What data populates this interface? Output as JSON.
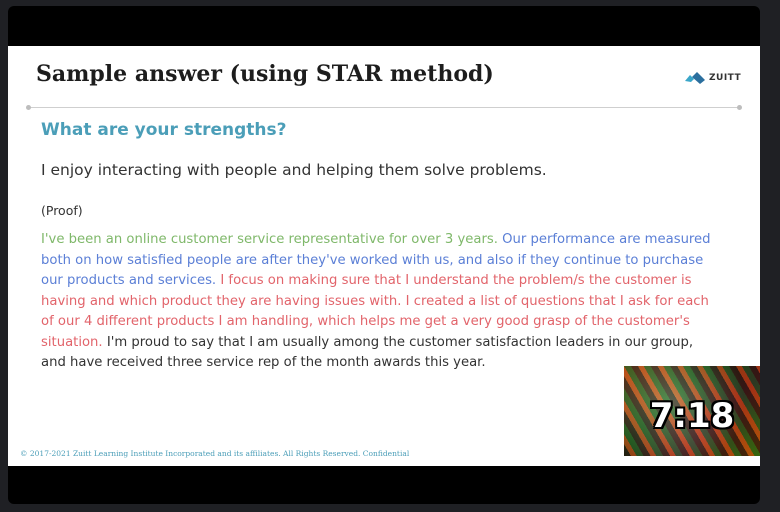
{
  "slide": {
    "title": "Sample answer (using STAR method)",
    "logo_text": "ZUITT",
    "question": "What are your strengths?",
    "statement": "I enjoy interacting with people and helping them solve problems.",
    "proof_label": "(Proof)",
    "answer": {
      "situation": "I've been an online customer service representative for over 3 years.",
      "task": "Our performance are measured both on how satisfied people are after they've worked with us, and also if they continue to purchase our products and services.",
      "action": "I focus on making sure that I understand the problem/s the customer is having and which product they are having issues with. I created a list of questions that I ask for each of our 4 different products I am handling, which helps me get a very good grasp of the customer's situation.",
      "result": "I'm proud to say that I am usually among the customer satisfaction leaders in our group, and have received three service rep of the month awards this year."
    },
    "footer": "© 2017-2021 Zuitt Learning Institute Incorporated and its affiliates. All Rights Reserved. Confidential"
  },
  "colors": {
    "question": "#4b9eb8",
    "situation": "#7fb86a",
    "task": "#5b7fd6",
    "action": "#e2646b",
    "result": "#333333"
  },
  "video_overlay": {
    "timer": "7:18"
  }
}
